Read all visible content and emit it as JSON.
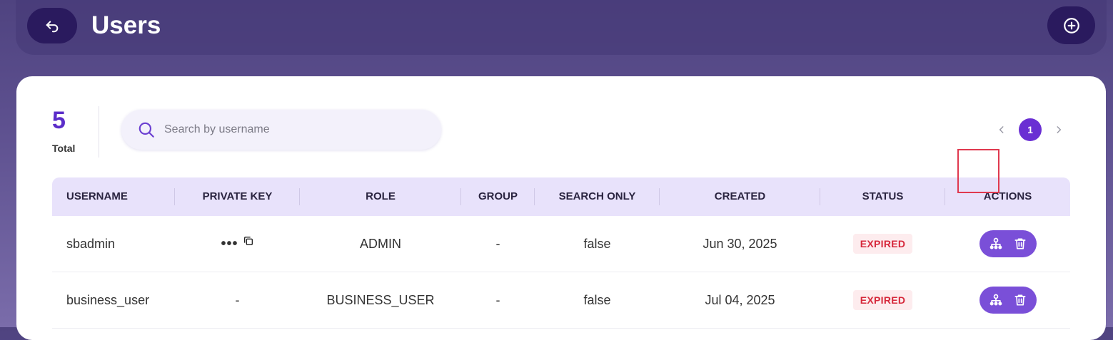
{
  "header": {
    "title": "Users",
    "back_icon": "back-arrow-icon",
    "add_icon": "plus-circle-icon",
    "accent": "#2a1a5e"
  },
  "summary": {
    "total_count": "5",
    "total_label": "Total"
  },
  "search": {
    "placeholder": "Search by username",
    "value": "",
    "icon": "search-icon"
  },
  "pagination": {
    "prev_icon": "chevron-left-icon",
    "current_page": "1",
    "next_icon": "chevron-right-icon",
    "accent": "#6a2fd3"
  },
  "table": {
    "columns": [
      "USERNAME",
      "PRIVATE KEY",
      "ROLE",
      "GROUP",
      "SEARCH ONLY",
      "CREATED",
      "STATUS",
      "ACTIONS"
    ],
    "rows": [
      {
        "username": "sbadmin",
        "private_key": "•••",
        "role": "ADMIN",
        "group": "-",
        "search_only": "false",
        "created": "Jun 30, 2025",
        "status": "EXPIRED"
      },
      {
        "username": "business_user",
        "private_key": "-",
        "role": "BUSINESS_USER",
        "group": "-",
        "search_only": "false",
        "created": "Jul 04, 2025",
        "status": "EXPIRED"
      }
    ],
    "action_icons": [
      "hierarchy-icon",
      "trash-icon"
    ],
    "status_color": "#d6283b"
  }
}
